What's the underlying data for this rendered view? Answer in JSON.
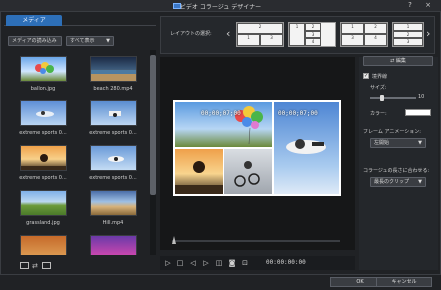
{
  "window": {
    "title": "ビデオ コラージュ デザイナー",
    "help_label": "?",
    "close_label": "×"
  },
  "tabs": [
    {
      "label": "メディア"
    }
  ],
  "toolbar": {
    "import_label": "メディアの読み込み",
    "filter_label": "すべて表示"
  },
  "media": {
    "items": [
      {
        "label": "ballon.jpg"
      },
      {
        "label": "beach 280.mp4"
      },
      {
        "label": "extreme sports 0..."
      },
      {
        "label": "extreme sports 0..."
      },
      {
        "label": "extreme sports 0..."
      },
      {
        "label": "extreme sports 0..."
      },
      {
        "label": "grassland.jpg"
      },
      {
        "label": "Hill.mp4"
      }
    ]
  },
  "layout": {
    "label": "レイアウトの選択:",
    "prev_label": "‹",
    "next_label": "›",
    "options": [
      {
        "cells": [
          "2",
          "1",
          "3"
        ]
      },
      {
        "cells": [
          "1",
          "2",
          "3",
          "4"
        ]
      },
      {
        "cells": [
          "1",
          "2",
          "3",
          "4"
        ]
      },
      {
        "cells": [
          "1",
          "2",
          "3"
        ]
      }
    ]
  },
  "preview": {
    "timecodes": [
      "00;00;07;00",
      "00;00;07;00"
    ]
  },
  "playback": {
    "timecode": "00:00:00:00"
  },
  "settings": {
    "edit_label": "編集",
    "frame_label": "境界線",
    "frame_checked": true,
    "size_label": "サイズ:",
    "size_value": "10",
    "size_fraction": 0.25,
    "color_label": "カラー:",
    "color_value": "#ffffff",
    "animation_label": "フレーム アニメーション:",
    "animation_value": "左開始",
    "duration_label": "コラージュの長さに合わせる:",
    "duration_value": "最長のクリップ"
  },
  "footer": {
    "ok_label": "OK",
    "cancel_label": "キャンセル"
  }
}
